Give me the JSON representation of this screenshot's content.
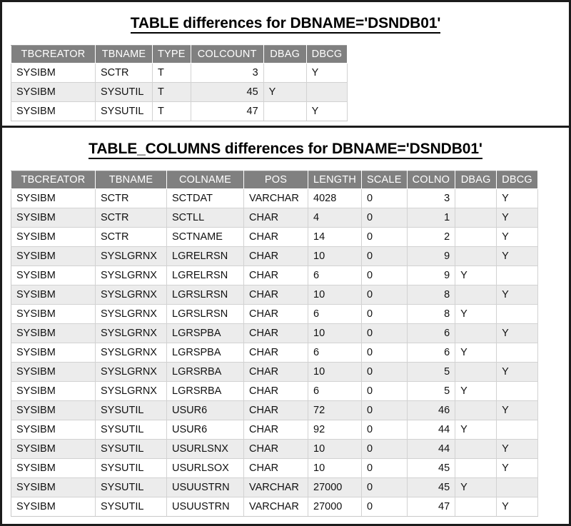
{
  "section1": {
    "title": "TABLE differences for DBNAME='DSNDB01'",
    "table": {
      "headers": [
        "TBCREATOR",
        "TBNAME",
        "TYPE",
        "COLCOUNT",
        "DBAG",
        "DBCG"
      ],
      "align": [
        "left",
        "left",
        "left",
        "right",
        "left",
        "left"
      ],
      "rows": [
        [
          "SYSIBM",
          "SCTR",
          "T",
          "3",
          "",
          "Y"
        ],
        [
          "SYSIBM",
          "SYSUTIL",
          "T",
          "45",
          "Y",
          ""
        ],
        [
          "SYSIBM",
          "SYSUTIL",
          "T",
          "47",
          "",
          "Y"
        ]
      ]
    }
  },
  "section2": {
    "title": "TABLE_COLUMNS differences for DBNAME='DSNDB01'",
    "table": {
      "headers": [
        "TBCREATOR",
        "TBNAME",
        "COLNAME",
        "POS",
        "LENGTH",
        "SCALE",
        "COLNO",
        "DBAG",
        "DBCG"
      ],
      "align": [
        "left",
        "left",
        "left",
        "left",
        "left",
        "left",
        "right",
        "left",
        "left"
      ],
      "rows": [
        [
          "SYSIBM",
          "SCTR",
          "SCTDAT",
          "VARCHAR",
          "4028",
          "0",
          "3",
          "",
          "Y"
        ],
        [
          "SYSIBM",
          "SCTR",
          "SCTLL",
          "CHAR",
          "4",
          "0",
          "1",
          "",
          "Y"
        ],
        [
          "SYSIBM",
          "SCTR",
          "SCTNAME",
          "CHAR",
          "14",
          "0",
          "2",
          "",
          "Y"
        ],
        [
          "SYSIBM",
          "SYSLGRNX",
          "LGRELRSN",
          "CHAR",
          "10",
          "0",
          "9",
          "",
          "Y"
        ],
        [
          "SYSIBM",
          "SYSLGRNX",
          "LGRELRSN",
          "CHAR",
          "6",
          "0",
          "9",
          "Y",
          ""
        ],
        [
          "SYSIBM",
          "SYSLGRNX",
          "LGRSLRSN",
          "CHAR",
          "10",
          "0",
          "8",
          "",
          "Y"
        ],
        [
          "SYSIBM",
          "SYSLGRNX",
          "LGRSLRSN",
          "CHAR",
          "6",
          "0",
          "8",
          "Y",
          ""
        ],
        [
          "SYSIBM",
          "SYSLGRNX",
          "LGRSPBA",
          "CHAR",
          "10",
          "0",
          "6",
          "",
          "Y"
        ],
        [
          "SYSIBM",
          "SYSLGRNX",
          "LGRSPBA",
          "CHAR",
          "6",
          "0",
          "6",
          "Y",
          ""
        ],
        [
          "SYSIBM",
          "SYSLGRNX",
          "LGRSRBA",
          "CHAR",
          "10",
          "0",
          "5",
          "",
          "Y"
        ],
        [
          "SYSIBM",
          "SYSLGRNX",
          "LGRSRBA",
          "CHAR",
          "6",
          "0",
          "5",
          "Y",
          ""
        ],
        [
          "SYSIBM",
          "SYSUTIL",
          "USUR6",
          "CHAR",
          "72",
          "0",
          "46",
          "",
          "Y"
        ],
        [
          "SYSIBM",
          "SYSUTIL",
          "USUR6",
          "CHAR",
          "92",
          "0",
          "44",
          "Y",
          ""
        ],
        [
          "SYSIBM",
          "SYSUTIL",
          "USURLSNX",
          "CHAR",
          "10",
          "0",
          "44",
          "",
          "Y"
        ],
        [
          "SYSIBM",
          "SYSUTIL",
          "USURLSOX",
          "CHAR",
          "10",
          "0",
          "45",
          "",
          "Y"
        ],
        [
          "SYSIBM",
          "SYSUTIL",
          "USUUSTRN",
          "VARCHAR",
          "27000",
          "0",
          "45",
          "Y",
          ""
        ],
        [
          "SYSIBM",
          "SYSUTIL",
          "USUUSTRN",
          "VARCHAR",
          "27000",
          "0",
          "47",
          "",
          "Y"
        ]
      ]
    }
  },
  "colors": {
    "header_bg": "#808080",
    "header_text": "#ffffff",
    "row_alt_bg": "#ececec",
    "page_border": "#1c1c1c",
    "grid_line": "#d2d2d2"
  }
}
